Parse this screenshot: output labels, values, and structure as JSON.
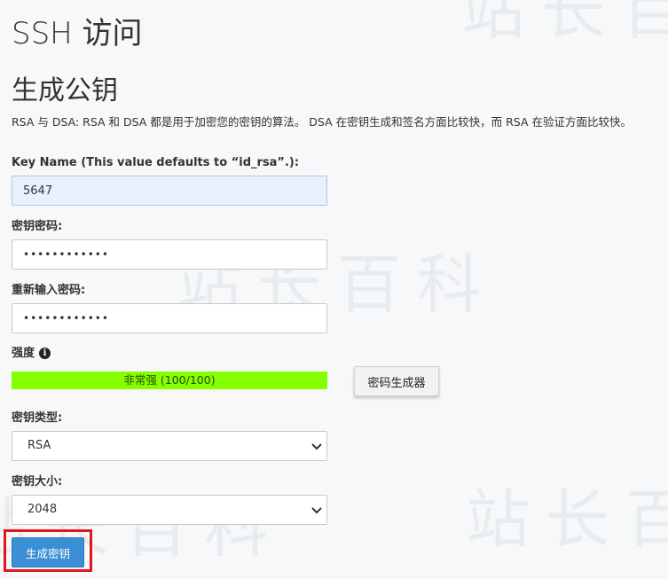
{
  "page": {
    "title": "SSH 访问",
    "section_title": "生成公钥",
    "description": "RSA 与 DSA: RSA 和 DSA 都是用于加密您的密钥的算法。 DSA 在密钥生成和签名方面比较快，而 RSA 在验证方面比较快。"
  },
  "watermark": {
    "text": "站长百科",
    "color": "#e4e8ec"
  },
  "form": {
    "key_name": {
      "label": "Key Name (This value defaults to “id_rsa”.):",
      "value": "5647"
    },
    "key_password": {
      "label": "密钥密码:",
      "value": "••••••••••••"
    },
    "key_password_confirm": {
      "label": "重新输入密码:",
      "value": "••••••••••••"
    },
    "strength": {
      "label": "强度",
      "info_icon": "info-circle-icon",
      "text": "非常强 (100/100)",
      "score": 100,
      "max": 100,
      "bar_color": "#86ff00"
    },
    "generator_button_label": "密码生成器",
    "key_type": {
      "label": "密钥类型:",
      "selected": "RSA"
    },
    "key_size": {
      "label": "密钥大小:",
      "selected": "2048"
    },
    "submit_label": "生成密钥",
    "submit_color": "#3b8fd6",
    "highlight_color": "#e3141c"
  }
}
